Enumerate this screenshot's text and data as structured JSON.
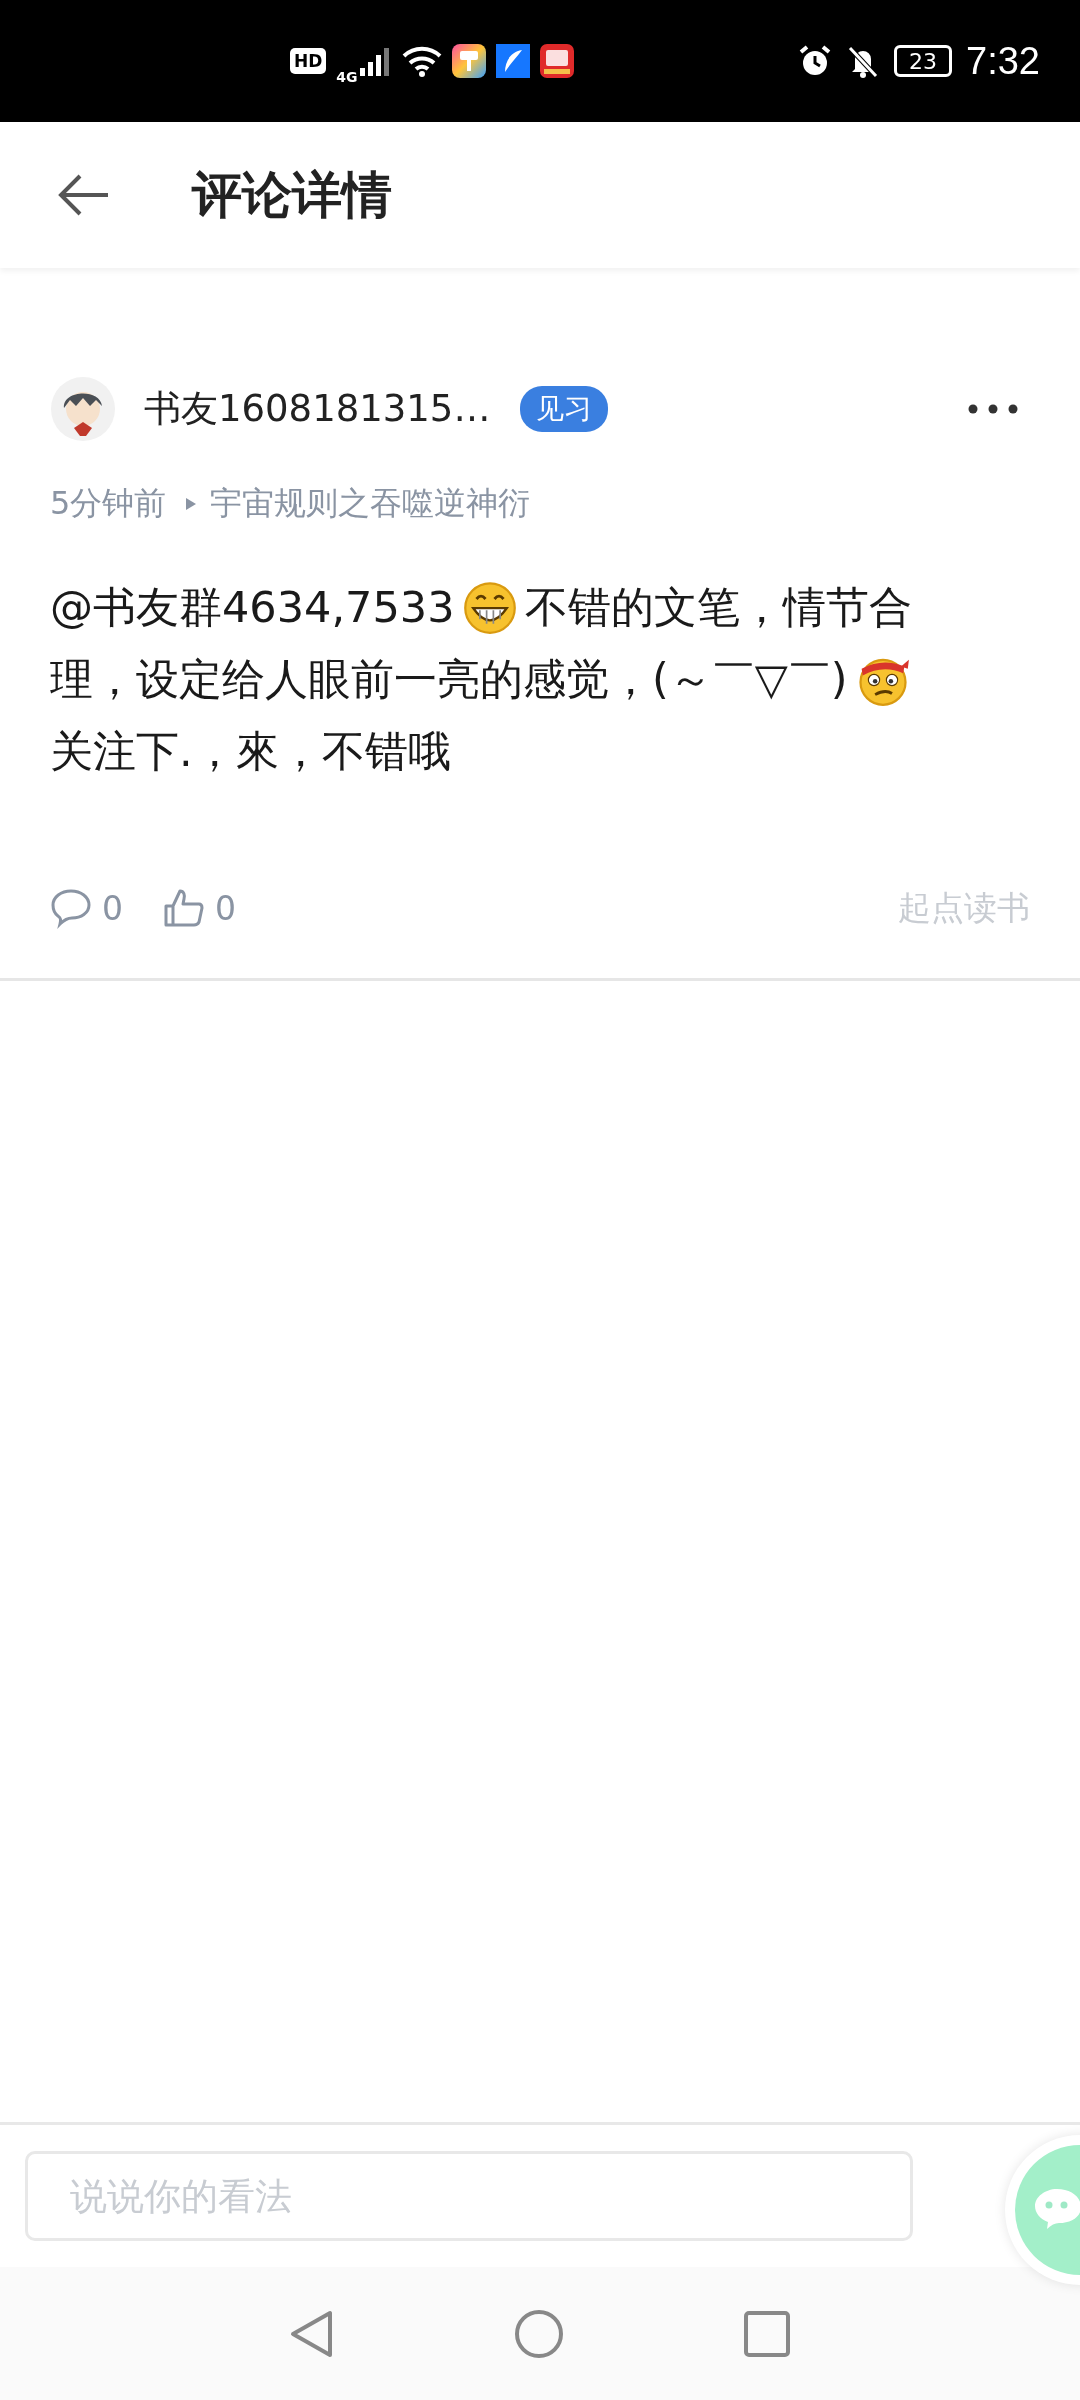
{
  "status_bar": {
    "hd": "HD",
    "network": "4G",
    "battery": "23",
    "time": "7:32"
  },
  "header": {
    "title": "评论详情"
  },
  "comment": {
    "author": "书友1608181315…",
    "badge": "见习",
    "time": "5分钟前",
    "book": "宇宙规则之吞噬逆神衍",
    "body_lines": [
      [
        {
          "kind": "text",
          "text": "@书友群4634,7533"
        },
        {
          "kind": "grin"
        },
        {
          "kind": "text",
          "text": "不错的文笔，情节合"
        }
      ],
      [
        {
          "kind": "text",
          "text": "理，设定给人眼前一亮的感觉，(～￣▽￣)"
        },
        {
          "kind": "frown"
        }
      ],
      [
        {
          "kind": "text",
          "text": "关注下.，來，不错哦"
        }
      ]
    ],
    "replies": "0",
    "likes": "0",
    "source": "起点读书"
  },
  "reply_bar": {
    "placeholder": "说说你的看法"
  }
}
